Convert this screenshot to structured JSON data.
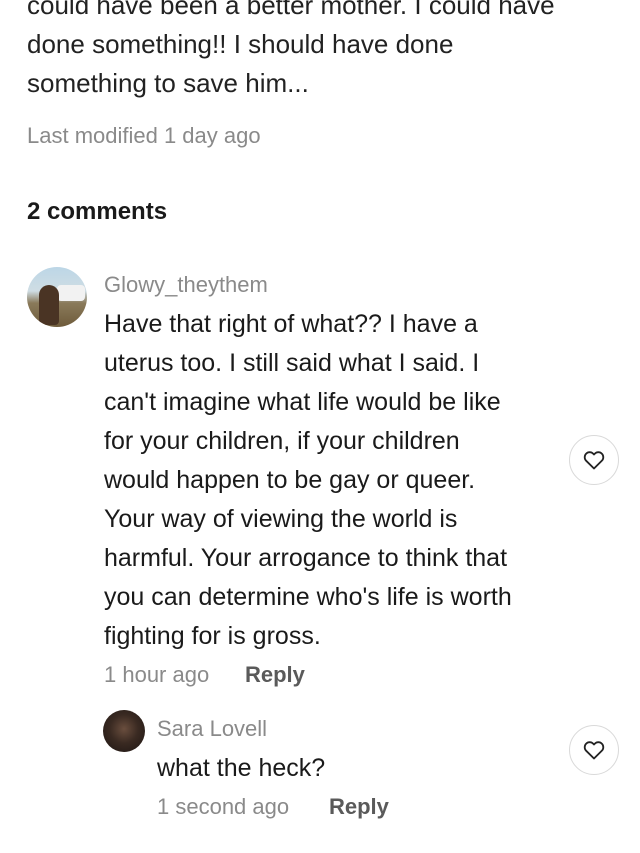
{
  "post": {
    "lines": [
      "could have been a better mother. I could have",
      "done something!! I should have done",
      "something to save him..."
    ],
    "modified": "Last modified 1 day ago"
  },
  "comments_header": "2 comments",
  "comments": [
    {
      "author": "Glowy_theythem",
      "lines": [
        "Have that right of what?? I have a",
        "uterus too. I still said what I said. I",
        "can't imagine what life would be like",
        "for your children, if your children",
        "would happen to be gay or queer.",
        "Your way of viewing the world is",
        "harmful. Your arrogance to think that",
        "you can determine who's life is worth",
        "fighting for is gross."
      ],
      "time": "1 hour ago",
      "reply_label": "Reply",
      "like_icon": "heart-outline-icon"
    },
    {
      "author": "Sara Lovell",
      "lines": [
        "what the heck?"
      ],
      "time": "1 second ago",
      "reply_label": "Reply",
      "like_icon": "heart-outline-icon"
    }
  ]
}
